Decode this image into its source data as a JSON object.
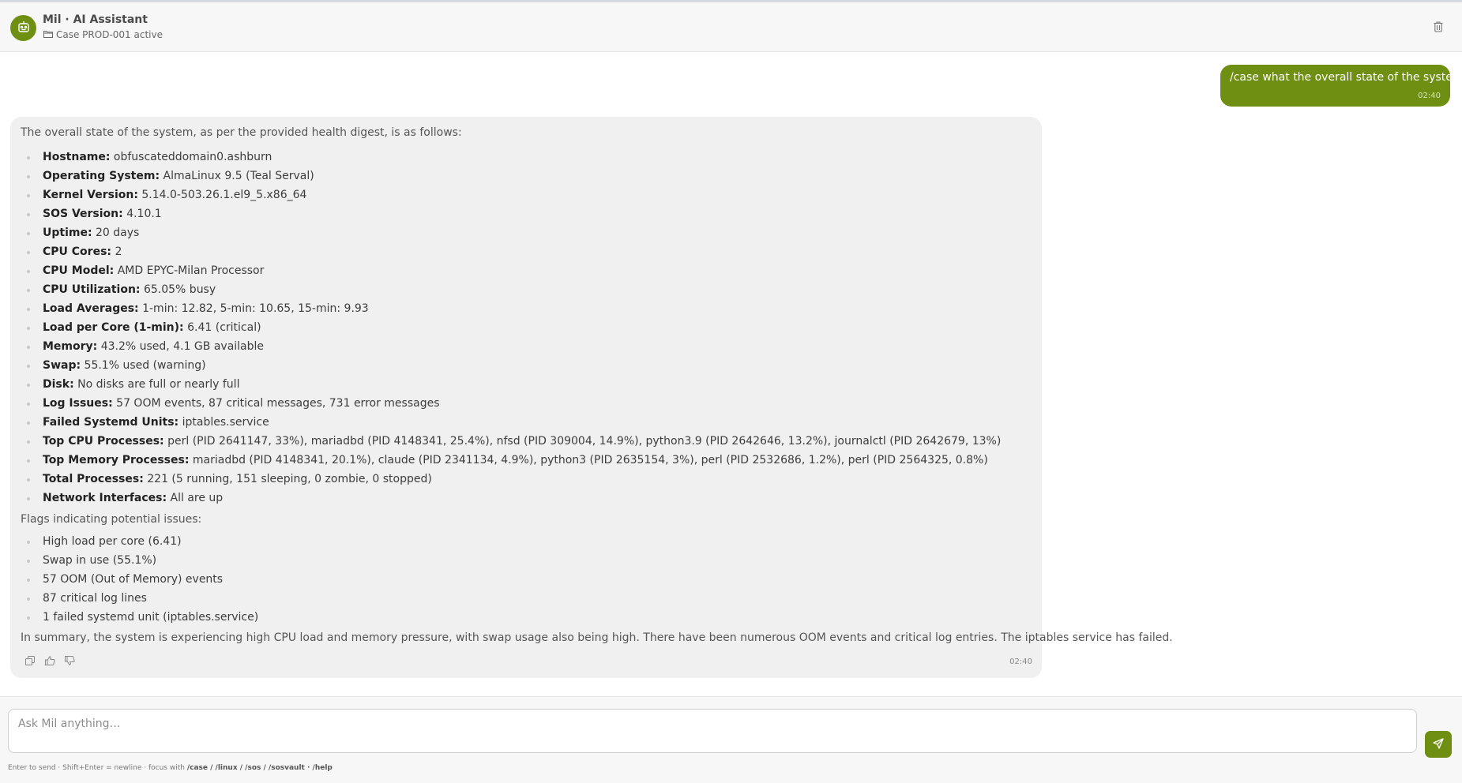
{
  "header": {
    "title": "Mil · AI Assistant",
    "case_status": "Case PROD-001 active"
  },
  "icons": {
    "avatar": "robot-icon",
    "case": "folder-icon",
    "trash": "trash-icon",
    "copy": "copy-icon",
    "thumbs_up": "thumbs-up-icon",
    "thumbs_down": "thumbs-down-icon",
    "send": "send-icon"
  },
  "colors": {
    "accent": "#6e8f12",
    "bubble_bg": "#f0f0f0"
  },
  "conversation": {
    "user_message": {
      "text": "/case what the overall state of the system?",
      "time": "02:40"
    },
    "assistant_message": {
      "intro": "The overall state of the system, as per the provided health digest, is as follows:",
      "facts": [
        {
          "label": "Hostname:",
          "value": "obfuscateddomain0.ashburn"
        },
        {
          "label": "Operating System:",
          "value": "AlmaLinux 9.5 (Teal Serval)"
        },
        {
          "label": "Kernel Version:",
          "value": "5.14.0-503.26.1.el9_5.x86_64"
        },
        {
          "label": "SOS Version:",
          "value": "4.10.1"
        },
        {
          "label": "Uptime:",
          "value": "20 days"
        },
        {
          "label": "CPU Cores:",
          "value": "2"
        },
        {
          "label": "CPU Model:",
          "value": "AMD EPYC-Milan Processor"
        },
        {
          "label": "CPU Utilization:",
          "value": "65.05% busy"
        },
        {
          "label": "Load Averages:",
          "value": "1-min: 12.82, 5-min: 10.65, 15-min: 9.93"
        },
        {
          "label": "Load per Core (1-min):",
          "value": "6.41 (critical)"
        },
        {
          "label": "Memory:",
          "value": "43.2% used, 4.1 GB available"
        },
        {
          "label": "Swap:",
          "value": "55.1% used (warning)"
        },
        {
          "label": "Disk:",
          "value": "No disks are full or nearly full"
        },
        {
          "label": "Log Issues:",
          "value": "57 OOM events, 87 critical messages, 731 error messages"
        },
        {
          "label": "Failed Systemd Units:",
          "value": "iptables.service"
        },
        {
          "label": "Top CPU Processes:",
          "value": "perl (PID 2641147, 33%), mariadbd (PID 4148341, 25.4%), nfsd (PID 309004, 14.9%), python3.9 (PID 2642646, 13.2%), journalctl (PID 2642679, 13%)"
        },
        {
          "label": "Top Memory Processes:",
          "value": "mariadbd (PID 4148341, 20.1%), claude (PID 2341134, 4.9%), python3 (PID 2635154, 3%), perl (PID 2532686, 1.2%), perl (PID 2564325, 0.8%)"
        },
        {
          "label": "Total Processes:",
          "value": "221 (5 running, 151 sleeping, 0 zombie, 0 stopped)"
        },
        {
          "label": "Network Interfaces:",
          "value": "All are up"
        }
      ],
      "flags_heading": "Flags indicating potential issues:",
      "flags": [
        "High load per core (6.41)",
        "Swap in use (55.1%)",
        "57 OOM (Out of Memory) events",
        "87 critical log lines",
        "1 failed systemd unit (iptables.service)"
      ],
      "summary": "In summary, the system is experiencing high CPU load and memory pressure, with swap usage also being high. There have been numerous OOM events and critical log entries. The iptables service has failed.",
      "time": "02:40"
    }
  },
  "composer": {
    "placeholder": "Ask Mil anything…",
    "hint_text": "Enter to send · Shift+Enter = newline · focus with",
    "hint_commands": "/case / /linux / /sos / /sosvault · /help"
  }
}
